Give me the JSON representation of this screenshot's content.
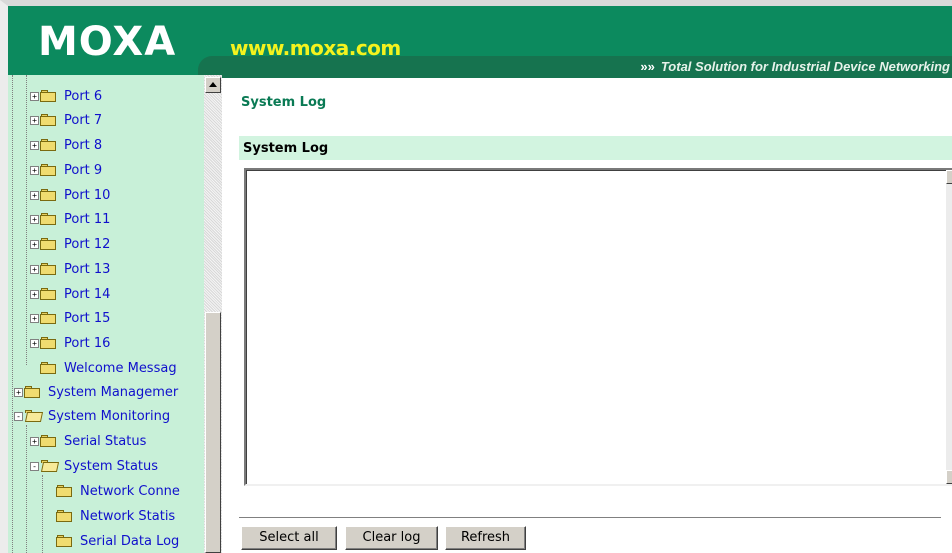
{
  "header": {
    "logo": "MOXA",
    "url": "www.moxa.com",
    "tagline_arrows": "»»",
    "tagline": "Total Solution for Industrial Device Networking",
    "colors": {
      "bar": "#0c8a5e",
      "url": "#f4f21e"
    }
  },
  "tree": {
    "items": [
      {
        "label": "Port 6",
        "expander": "+"
      },
      {
        "label": "Port 7",
        "expander": "+"
      },
      {
        "label": "Port 8",
        "expander": "+"
      },
      {
        "label": "Port 9",
        "expander": "+"
      },
      {
        "label": "Port 10",
        "expander": "+"
      },
      {
        "label": "Port 11",
        "expander": "+"
      },
      {
        "label": "Port 12",
        "expander": "+"
      },
      {
        "label": "Port 13",
        "expander": "+"
      },
      {
        "label": "Port 14",
        "expander": "+"
      },
      {
        "label": "Port 15",
        "expander": "+"
      },
      {
        "label": "Port 16",
        "expander": "+"
      },
      {
        "label": "Welcome Messag",
        "expander": ""
      },
      {
        "label": "System Managemer",
        "expander": "+"
      },
      {
        "label": "System Monitoring",
        "expander": "-"
      },
      {
        "label": "Serial Status",
        "expander": "+"
      },
      {
        "label": "System Status",
        "expander": "-"
      },
      {
        "label": "Network Conne",
        "expander": ""
      },
      {
        "label": "Network Statis",
        "expander": ""
      },
      {
        "label": "Serial Data Log",
        "expander": ""
      }
    ]
  },
  "main": {
    "page_title": "System Log",
    "section_title": "System Log",
    "log_value": "",
    "buttons": {
      "select_all": "Select all",
      "clear_log": "Clear log",
      "refresh": "Refresh"
    }
  }
}
